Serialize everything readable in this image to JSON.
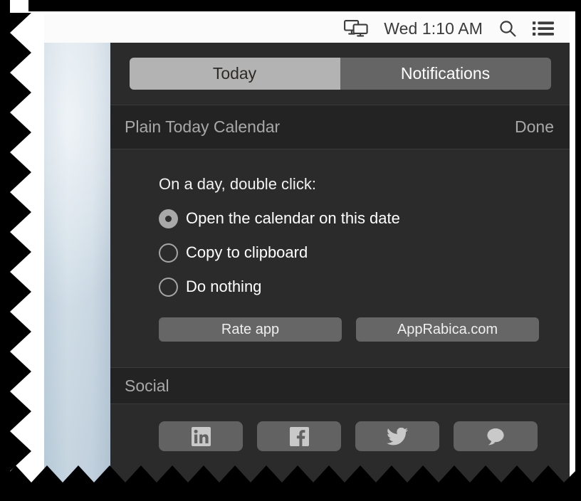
{
  "menubar": {
    "screen_mirroring_icon": "screen-mirroring-icon",
    "clock": "Wed 1:10 AM",
    "search_icon": "search-icon",
    "notification_center_icon": "notification-center-icon"
  },
  "notification_center": {
    "tabs": [
      {
        "label": "Today",
        "selected": true
      },
      {
        "label": "Notifications",
        "selected": false
      }
    ],
    "widget": {
      "title": "Plain Today Calendar",
      "done_label": "Done",
      "prompt": "On a day, double click:",
      "options": [
        {
          "label": "Open the calendar on this date",
          "selected": true
        },
        {
          "label": "Copy to clipboard",
          "selected": false
        },
        {
          "label": "Do nothing",
          "selected": false
        }
      ],
      "buttons": [
        {
          "label": "Rate app"
        },
        {
          "label": "AppRabica.com"
        }
      ]
    },
    "social": {
      "title": "Social",
      "items": [
        {
          "icon": "linkedin-icon"
        },
        {
          "icon": "facebook-icon"
        },
        {
          "icon": "twitter-icon"
        },
        {
          "icon": "chat-bubble-icon"
        }
      ]
    }
  },
  "colors": {
    "panel_bg": "#2b2b2b",
    "header_bg": "#232323",
    "tab_active_bg": "#b3b3b3",
    "tab_inactive_bg": "#656565",
    "button_bg": "#666666",
    "menubar_bg": "#fbfbfb",
    "text_primary": "#ffffff",
    "text_secondary": "#a8a8a8",
    "tear_color": "#ffffff"
  }
}
